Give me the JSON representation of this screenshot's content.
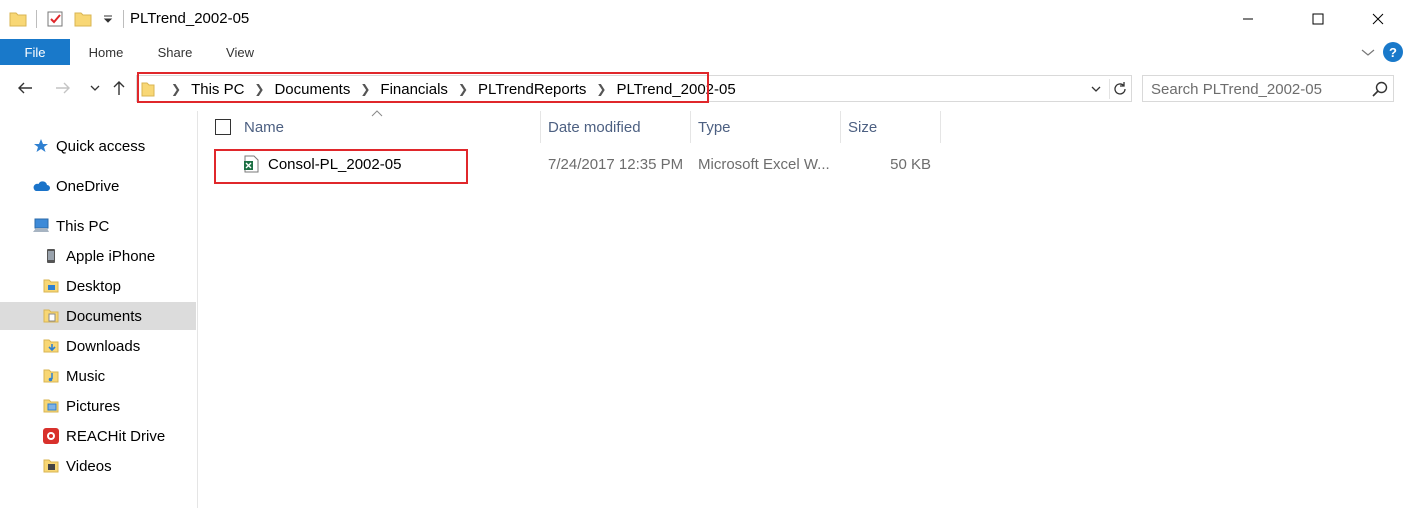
{
  "window": {
    "title": "PLTrend_2002-05"
  },
  "ribbon": {
    "tabs": [
      {
        "label": "File"
      },
      {
        "label": "Home"
      },
      {
        "label": "Share"
      },
      {
        "label": "View"
      }
    ],
    "help_label": "?"
  },
  "address": {
    "breadcrumbs": [
      "This PC",
      "Documents",
      "Financials",
      "PLTrendReports",
      "PLTrend_2002-05"
    ]
  },
  "search": {
    "placeholder": "Search PLTrend_2002-05"
  },
  "navpane": {
    "items": [
      {
        "label": "Quick access",
        "icon": "star-icon"
      },
      {
        "label": "OneDrive",
        "icon": "cloud-icon"
      },
      {
        "label": "This PC",
        "icon": "computer-icon"
      },
      {
        "label": "Apple iPhone",
        "icon": "phone-icon"
      },
      {
        "label": "Desktop",
        "icon": "desktop-folder-icon"
      },
      {
        "label": "Documents",
        "icon": "documents-folder-icon",
        "selected": true
      },
      {
        "label": "Downloads",
        "icon": "downloads-folder-icon"
      },
      {
        "label": "Music",
        "icon": "music-folder-icon"
      },
      {
        "label": "Pictures",
        "icon": "pictures-folder-icon"
      },
      {
        "label": "REACHit Drive",
        "icon": "reachit-drive-icon"
      },
      {
        "label": "Videos",
        "icon": "videos-folder-icon"
      }
    ]
  },
  "columns": {
    "name": "Name",
    "date_modified": "Date modified",
    "type": "Type",
    "size": "Size"
  },
  "files": [
    {
      "name": "Consol-PL_2002-05",
      "date_modified": "7/24/2017 12:35 PM",
      "type": "Microsoft Excel W...",
      "size": "50 KB",
      "icon": "excel-file-icon"
    }
  ],
  "colors": {
    "accent": "#1979ca",
    "highlight_box": "#e0272b",
    "selection": "#dcdcdc",
    "folder": "#f8d775"
  }
}
